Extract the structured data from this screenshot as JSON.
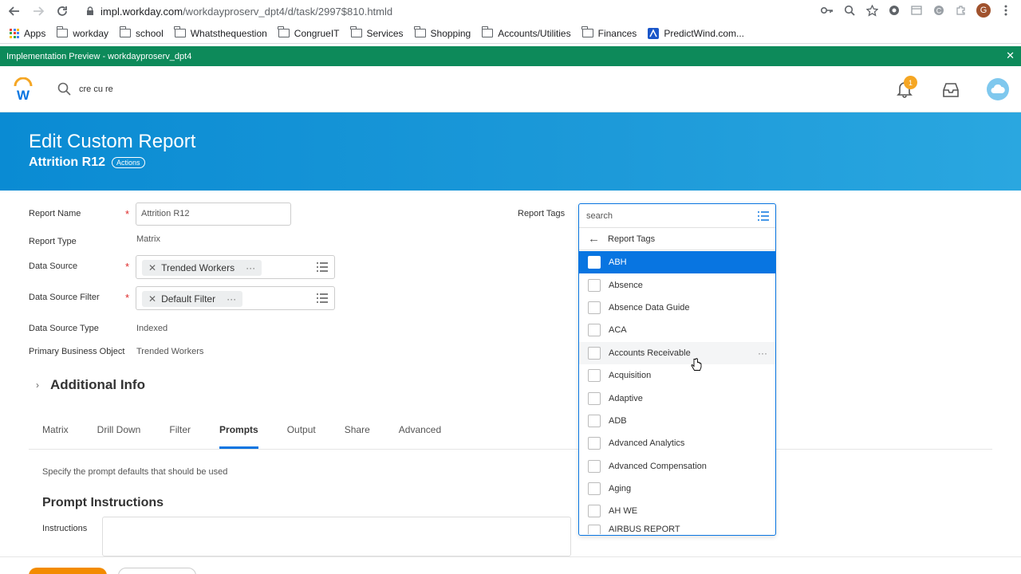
{
  "browser": {
    "url_host": "impl.workday.com",
    "url_path": "/workdayproserv_dpt4/d/task/2997$810.htmld",
    "bookmarks": [
      {
        "label": "Apps",
        "icon": "apps-grid-icon"
      },
      {
        "label": "workday",
        "icon": "folder-icon"
      },
      {
        "label": "school",
        "icon": "folder-icon"
      },
      {
        "label": "Whatsthequestion",
        "icon": "folder-icon"
      },
      {
        "label": "CongrueIT",
        "icon": "folder-icon"
      },
      {
        "label": "Services",
        "icon": "folder-icon"
      },
      {
        "label": "Shopping",
        "icon": "folder-icon"
      },
      {
        "label": "Accounts/Utilities",
        "icon": "folder-icon"
      },
      {
        "label": "Finances",
        "icon": "folder-icon"
      },
      {
        "label": "PredictWind.com...",
        "icon": "predictwind-icon"
      }
    ],
    "profile_initial": "G"
  },
  "impl_bar": {
    "text": "Implementation Preview - workdayproserv_dpt4",
    "color": "#0d8a5a"
  },
  "header": {
    "search_value": "cre cu re",
    "notification_count": "1"
  },
  "page": {
    "title": "Edit Custom Report",
    "subtitle": "Attrition R12",
    "actions_label": "Actions"
  },
  "form": {
    "report_name_label": "Report Name",
    "report_name_value": "Attrition R12",
    "report_type_label": "Report Type",
    "report_type_value": "Matrix",
    "data_source_label": "Data Source",
    "data_source_value": "Trended Workers",
    "data_source_filter_label": "Data Source Filter",
    "data_source_filter_value": "Default Filter",
    "data_source_type_label": "Data Source Type",
    "data_source_type_value": "Indexed",
    "primary_bo_label": "Primary Business Object",
    "primary_bo_value": "Trended Workers",
    "report_tags_label": "Report Tags",
    "required_mark": "*"
  },
  "additional_info": "Additional Info",
  "tabs": [
    "Matrix",
    "Drill Down",
    "Filter",
    "Prompts",
    "Output",
    "Share",
    "Advanced"
  ],
  "active_tab": "Prompts",
  "prompts": {
    "hint": "Specify the prompt defaults that should be used",
    "header": "Prompt Instructions",
    "instructions_label": "Instructions"
  },
  "tags_dropdown": {
    "search_placeholder": "search",
    "back_label": "Report Tags",
    "items": [
      {
        "label": "ABH",
        "state": "selected"
      },
      {
        "label": "Absence",
        "state": ""
      },
      {
        "label": "Absence Data Guide",
        "state": ""
      },
      {
        "label": "ACA",
        "state": ""
      },
      {
        "label": "Accounts Receivable",
        "state": "hover"
      },
      {
        "label": "Acquisition",
        "state": ""
      },
      {
        "label": "Adaptive",
        "state": ""
      },
      {
        "label": "ADB",
        "state": ""
      },
      {
        "label": "Advanced Analytics",
        "state": ""
      },
      {
        "label": "Advanced Compensation",
        "state": ""
      },
      {
        "label": "Aging",
        "state": ""
      },
      {
        "label": "AH WE",
        "state": ""
      },
      {
        "label": "AIRBUS REPORT",
        "state": "cut"
      }
    ],
    "accent": "#0875e1"
  }
}
